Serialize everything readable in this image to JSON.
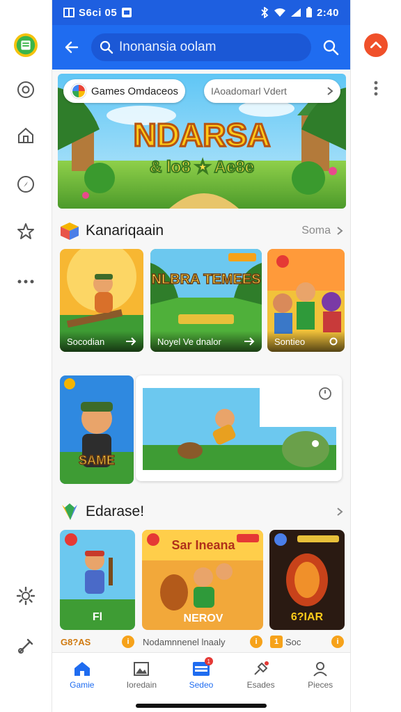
{
  "status": {
    "left_text": "S6ci 05",
    "time": "2:40"
  },
  "search": {
    "query": "Inonansia oolam"
  },
  "hero": {
    "chip_left": "Games Omdaceos",
    "chip_right": "IAoadomarl Vdert",
    "title": "NDARSA",
    "subtitle": "& lo8 ★ Ae8e"
  },
  "section1": {
    "title": "Kanariqaain",
    "more": "Soma",
    "cards": [
      {
        "caption": "Socodian",
        "art_title": ""
      },
      {
        "caption": "Noyel Ve dnalor",
        "art_title": "NLBRA TEMEES"
      },
      {
        "caption": "Sontieo",
        "art_title": ""
      }
    ]
  },
  "featured": {
    "badge": "SAME"
  },
  "section2": {
    "title": "Edarase!",
    "cards": [
      {
        "art_text": "Fl",
        "label": "G8?AS"
      },
      {
        "art_text": "NEROV",
        "art_title": "Sar Ineana",
        "label": "Nodamnnenel lnaaly"
      },
      {
        "art_text": "6?IAR",
        "label": "Soc"
      }
    ]
  },
  "bottom_nav": [
    {
      "label": "Gamie"
    },
    {
      "label": "Ioredain"
    },
    {
      "label": "Sedeo",
      "badge": "1"
    },
    {
      "label": "Esades"
    },
    {
      "label": "Pieces"
    }
  ],
  "colors": {
    "primary": "#1f6cf0",
    "status": "#1e5fe0",
    "accent_orange": "#f6a21a"
  }
}
